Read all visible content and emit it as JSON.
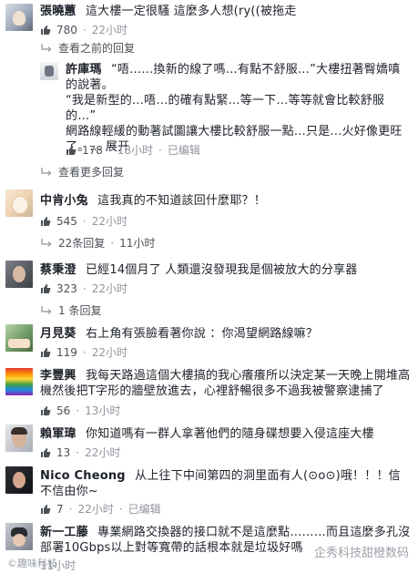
{
  "comments": [
    {
      "name": "張曉蕙",
      "text": "這大樓一定很騷 這麼多人想(ry((被拖走",
      "likes": "780",
      "time": "22小时"
    },
    {
      "name": "許庫瑪",
      "text": "“唔……換新的線了嗎…有點不舒服…”大樓扭著臀嬌嗔的說著。\n“我是新型的…唔…的確有點緊…等一下…等等就會比較舒服的…”\n網路線輕緩的動著試圖讓大樓比較舒服一點…只是…火好像更旺了。… 展开",
      "likes": "178",
      "time": "18小时",
      "status": "已编辑"
    },
    {
      "name": "中肯小兔",
      "text": "這我真的不知道該回什麼耶？！",
      "likes": "545",
      "time": "22小时"
    },
    {
      "name": "蔡秉澄",
      "text": "已經14個月了 人類還沒發現我是個被放大的分享器",
      "likes": "323",
      "time": "22小时"
    },
    {
      "name": "月見葵",
      "text": "右上角有張臉看著你說 ：你渴望網路線嘛？",
      "likes": "119",
      "time": "22小时"
    },
    {
      "name": "李豐興",
      "text": "我每天路過這個大樓搞的我心癢癢所以決定某一天晚上開堆高機然後把T字形的牆壁放進去，心裡舒暢很多不過我被警察逮捕了",
      "likes": "56",
      "time": "13小时"
    },
    {
      "name": "賴軍瑋",
      "text": "你知道嗎有一群人拿著他們的隨身碟想要入侵這座大樓",
      "likes": "13",
      "time": "22小时"
    },
    {
      "name": "Nico Cheong",
      "text": "从上往下中间第四的洞里面有人(⊙o⊙)哦！！！信不信由你~",
      "likes": "7",
      "time": "22小时",
      "status": "已编辑"
    },
    {
      "name": "新一工藤",
      "text": "專業網路交換器的接口就不是這麼點………而且這麼多孔沒部署10Gbps以上對等寬帶的話根本就是垃圾好嗎",
      "time": "11小时"
    }
  ],
  "reply_links": {
    "view_previous": "查看之前的回复",
    "view_more": "查看更多回复",
    "replies_22": "22条回复",
    "replies_22_time": "11小时",
    "reply_1": "1 条回复"
  },
  "watermarks": {
    "right": "企秀科技甜橙数码",
    "left": "©趣味科技"
  },
  "colors": {
    "link": "#4b4f56",
    "meta": "#90949c",
    "like_blue": "#5890ff"
  }
}
